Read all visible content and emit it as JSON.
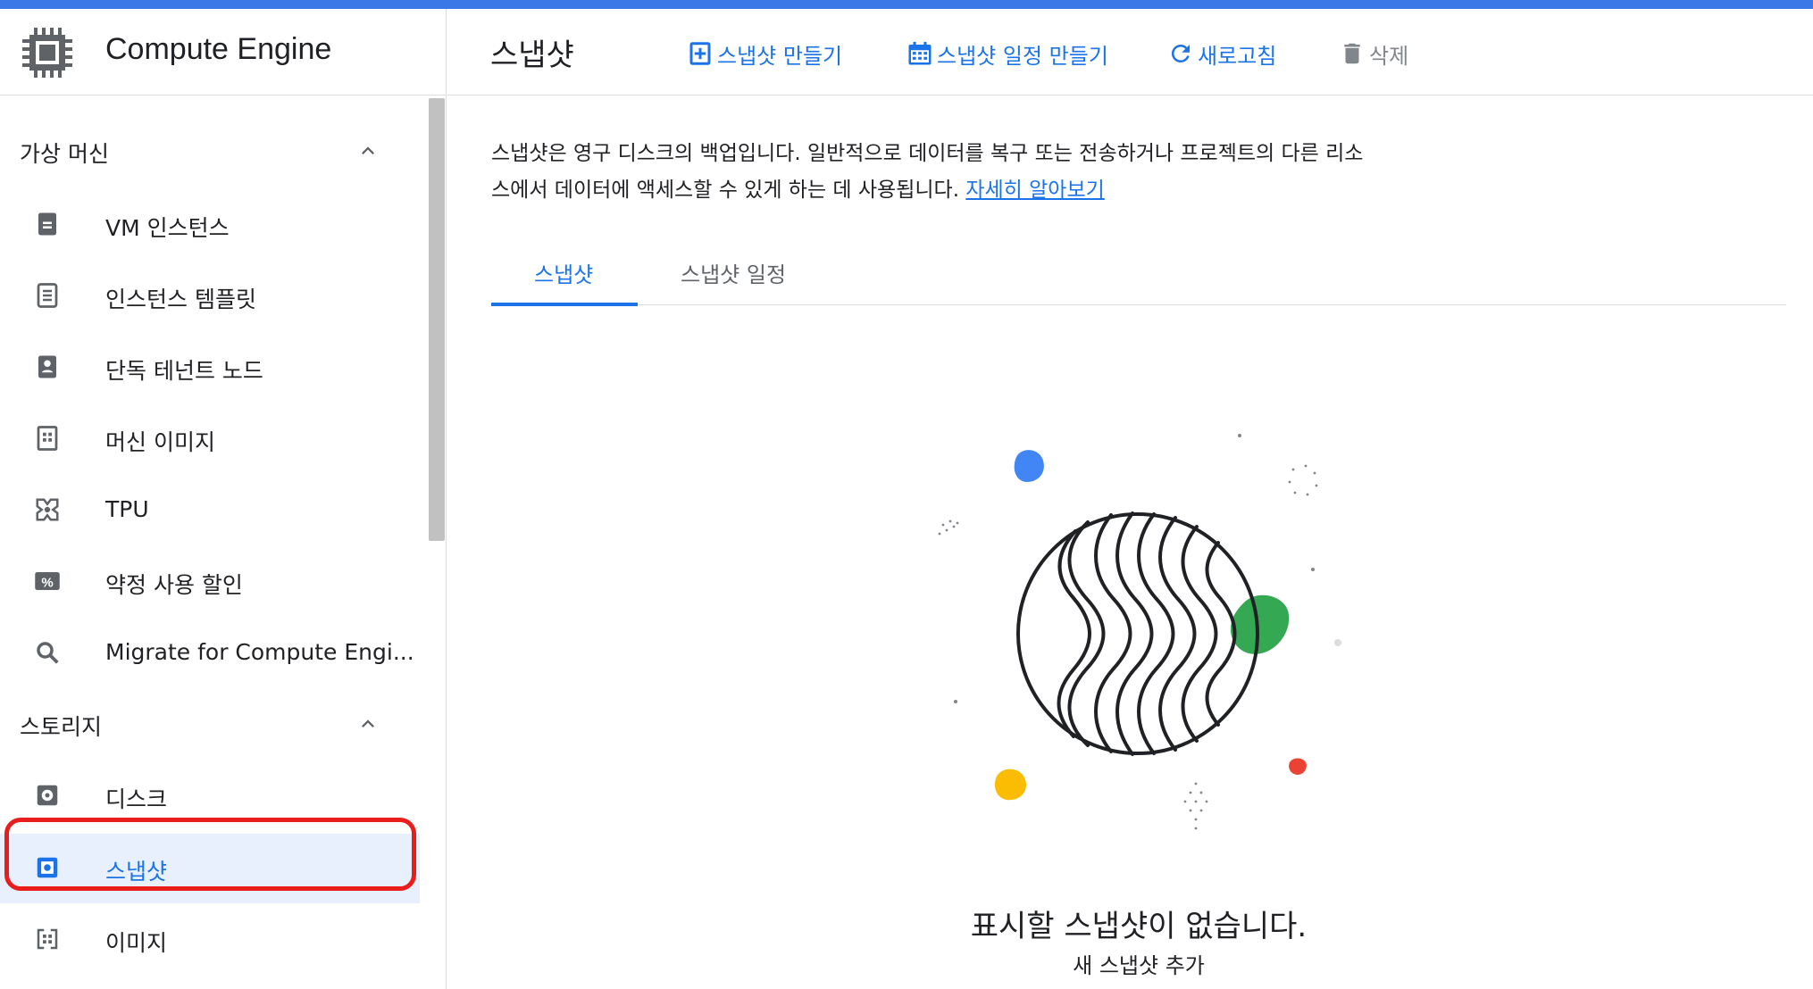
{
  "app": {
    "product_name": "Compute Engine",
    "accent_color": "#1a73e8",
    "topbar_color": "#3b78e7"
  },
  "sidebar": {
    "sections": [
      {
        "label": "가상 머신",
        "icon": "chevron-up-icon"
      },
      {
        "label": "스토리지",
        "icon": "chevron-up-icon"
      }
    ],
    "vm_items": [
      {
        "label": "VM 인스턴스",
        "icon": "vm-instance-icon"
      },
      {
        "label": "인스턴스 템플릿",
        "icon": "instance-template-icon"
      },
      {
        "label": "단독 테넌트 노드",
        "icon": "sole-tenant-node-icon"
      },
      {
        "label": "머신 이미지",
        "icon": "machine-image-icon"
      },
      {
        "label": "TPU",
        "icon": "tpu-icon"
      },
      {
        "label": "약정 사용 할인",
        "icon": "percent-icon"
      },
      {
        "label": "Migrate for Compute Engi...",
        "icon": "search-icon"
      }
    ],
    "storage_items": [
      {
        "label": "디스크",
        "icon": "disk-icon"
      },
      {
        "label": "스냅샷",
        "icon": "snapshot-icon",
        "active": true
      },
      {
        "label": "이미지",
        "icon": "image-icon"
      }
    ]
  },
  "header": {
    "title": "스냅샷",
    "actions": [
      {
        "label": "스냅샷 만들기",
        "icon": "add-box-icon"
      },
      {
        "label": "스냅샷 일정 만들기",
        "icon": "calendar-icon"
      },
      {
        "label": "새로고침",
        "icon": "refresh-icon"
      },
      {
        "label": "삭제",
        "icon": "trash-icon",
        "disabled": true
      }
    ]
  },
  "main": {
    "description_line1": "스냅샷은 영구 디스크의 백업입니다. 일반적으로 데이터를 복구 또는 전송하거나 프로젝트의 다른 리소",
    "description_line2": "스에서 데이터에 액세스할 수 있게 하는 데 사용됩니다.",
    "learn_more": "자세히 알아보기",
    "tabs": [
      {
        "label": "스냅샷",
        "active": true
      },
      {
        "label": "스냅샷 일정",
        "active": false
      }
    ],
    "empty_state": {
      "title": "표시할 스냅샷이 없습니다.",
      "subtitle": "새 스냅샷 추가",
      "illustration": "globe-illustration"
    }
  }
}
